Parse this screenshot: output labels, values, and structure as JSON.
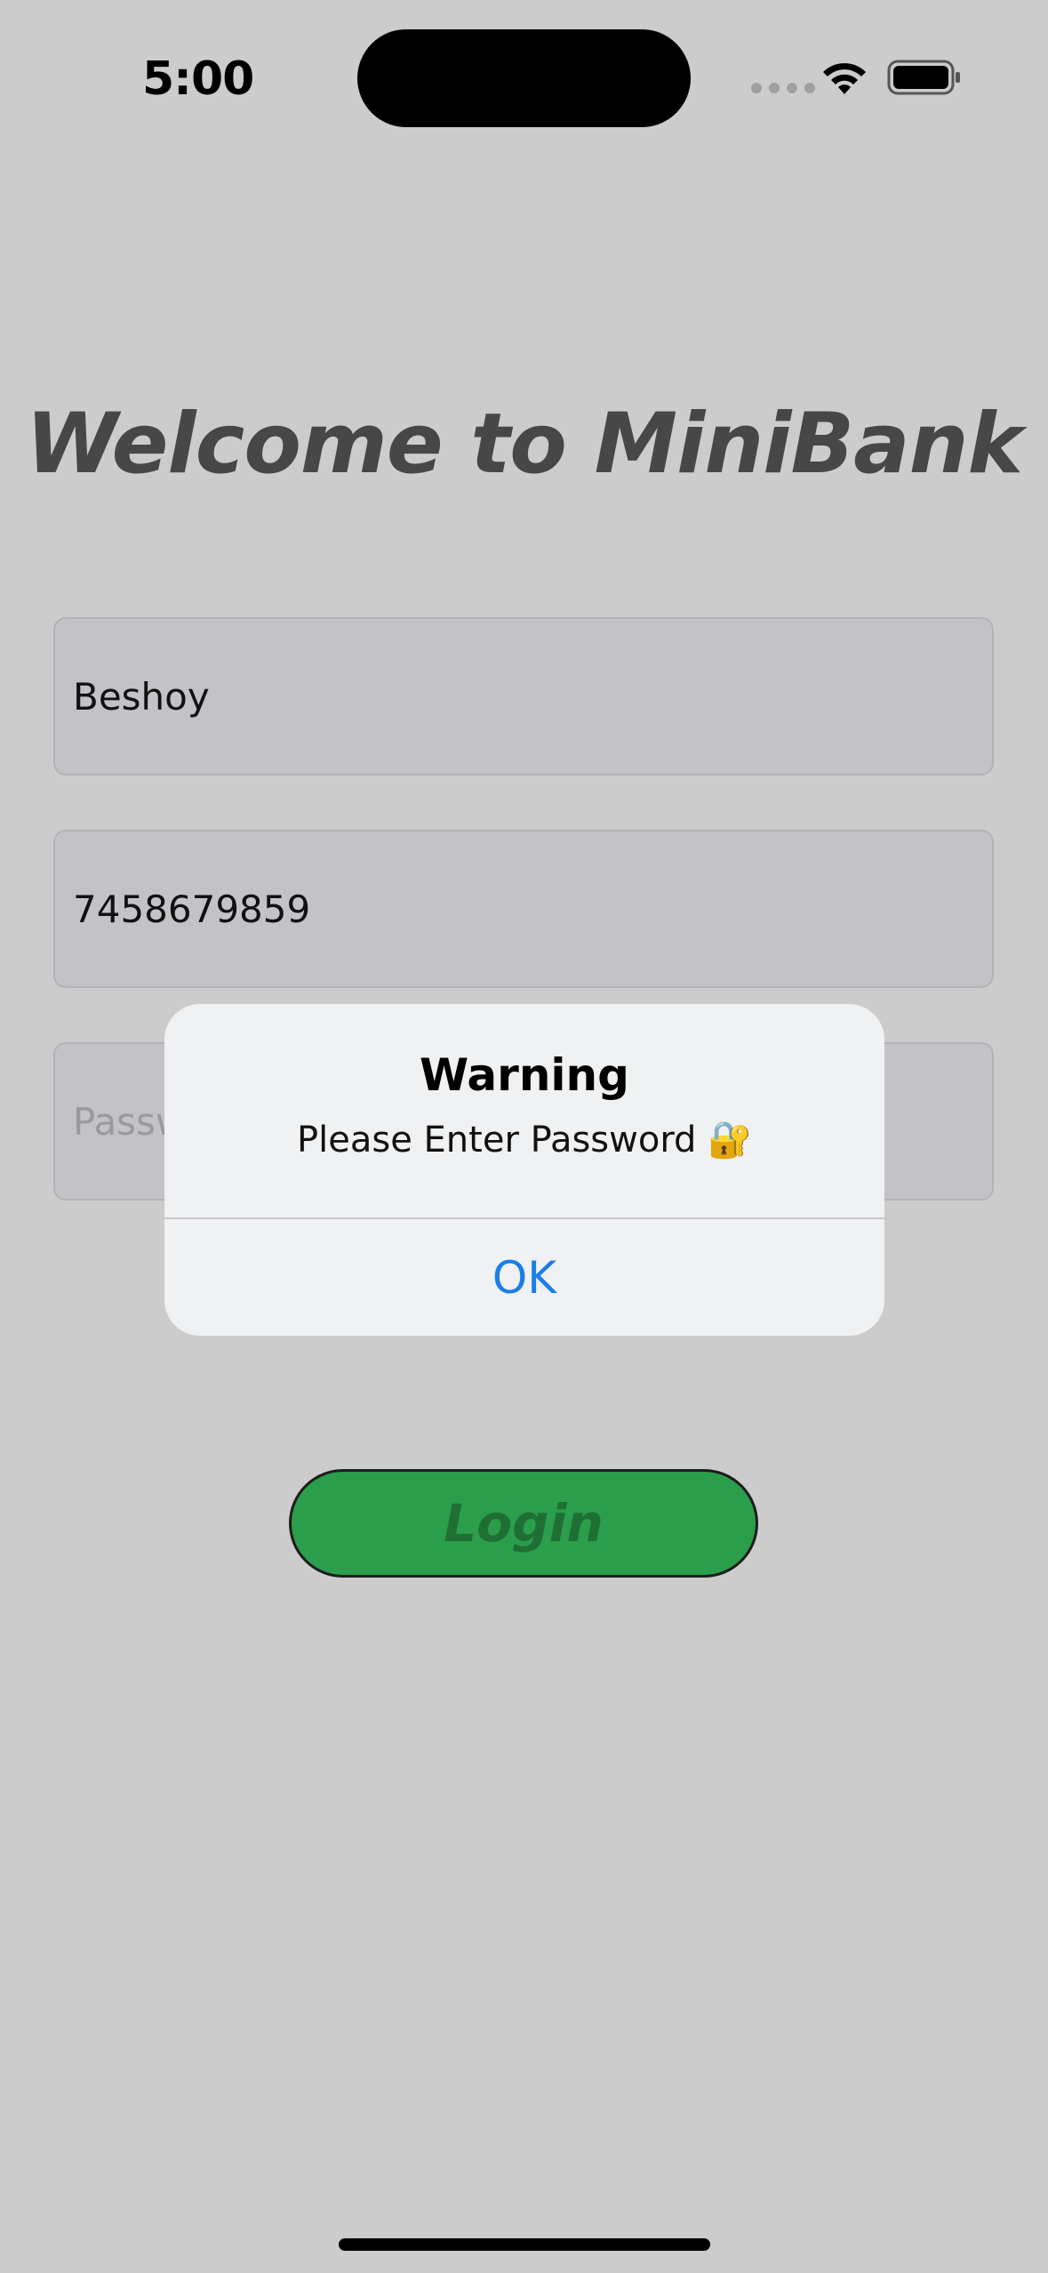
{
  "status_bar": {
    "time": "5:00"
  },
  "title": "Welcome to MiniBank",
  "form": {
    "name_value": "Beshoy",
    "phone_value": "7458679859",
    "password_placeholder": "Passw"
  },
  "login_button": {
    "label": "Login"
  },
  "alert": {
    "title": "Warning",
    "message": "Please Enter Password 🔐",
    "ok_label": "OK"
  },
  "colors": {
    "background": "#cccccc",
    "login_green": "#2a9e4a",
    "alert_link_blue": "#1a7ee6"
  }
}
